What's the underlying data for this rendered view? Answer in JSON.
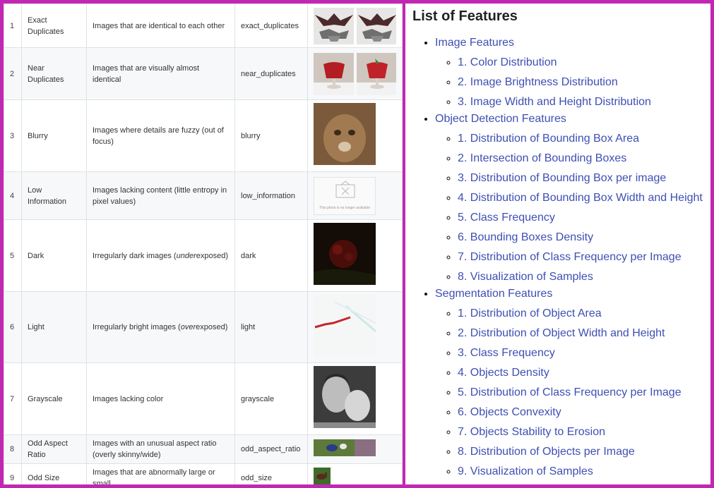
{
  "issues_table": {
    "rows": [
      {
        "num": "1",
        "name": "Exact Duplicates",
        "desc": "Images that are identical to each other",
        "key": "exact_duplicates"
      },
      {
        "num": "2",
        "name": "Near Duplicates",
        "desc": "Images that are visually almost identical",
        "key": "near_duplicates"
      },
      {
        "num": "3",
        "name": "Blurry",
        "desc": "Images where details are fuzzy (out of focus)",
        "key": "blurry"
      },
      {
        "num": "4",
        "name": "Low Information",
        "desc": "Images lacking content (little entropy in pixel values)",
        "key": "low_information",
        "thumb_caption": "This photo is no longer available"
      },
      {
        "num": "5",
        "name": "Dark",
        "desc_before": "Irregularly dark images (",
        "desc_em": "under",
        "desc_after": "exposed)",
        "key": "dark"
      },
      {
        "num": "6",
        "name": "Light",
        "desc_before": "Irregularly bright images (",
        "desc_em": "over",
        "desc_after": "exposed)",
        "key": "light"
      },
      {
        "num": "7",
        "name": "Grayscale",
        "desc": "Images lacking color",
        "key": "grayscale"
      },
      {
        "num": "8",
        "name": "Odd Aspect Ratio",
        "desc": "Images with an unusual aspect ratio (overly skinny/wide)",
        "key": "odd_aspect_ratio"
      },
      {
        "num": "9",
        "name": "Odd Size",
        "desc": "Images that are abnormally large or small",
        "key": "odd_size"
      }
    ]
  },
  "features": {
    "title": "List of Features",
    "sections": [
      {
        "label": "Image Features",
        "items": [
          "1. Color Distribution",
          "2. Image Brightness Distribution",
          "3. Image Width and Height Distribution"
        ]
      },
      {
        "label": "Object Detection Features",
        "items": [
          "1. Distribution of Bounding Box Area",
          "2. Intersection of Bounding Boxes",
          "3. Distribution of Bounding Box per image",
          "4. Distribution of Bounding Box Width and Height",
          "5. Class Frequency",
          "6. Bounding Boxes Density",
          "7. Distribution of Class Frequency per Image",
          "8. Visualization of Samples"
        ]
      },
      {
        "label": "Segmentation Features",
        "items": [
          "1. Distribution of Object Area",
          "2. Distribution of Object Width and Height",
          "3. Class Frequency",
          "4. Objects Density",
          "5. Distribution of Class Frequency per Image",
          "6. Objects Convexity",
          "7. Objects Stability to Erosion",
          "8. Distribution of Objects per Image",
          "9. Visualization of Samples"
        ]
      }
    ]
  },
  "colors": {
    "frame": "#c227b4",
    "link": "#3e4fb3",
    "row_alt": "#f6f8fa",
    "border": "#dfe2e5"
  }
}
